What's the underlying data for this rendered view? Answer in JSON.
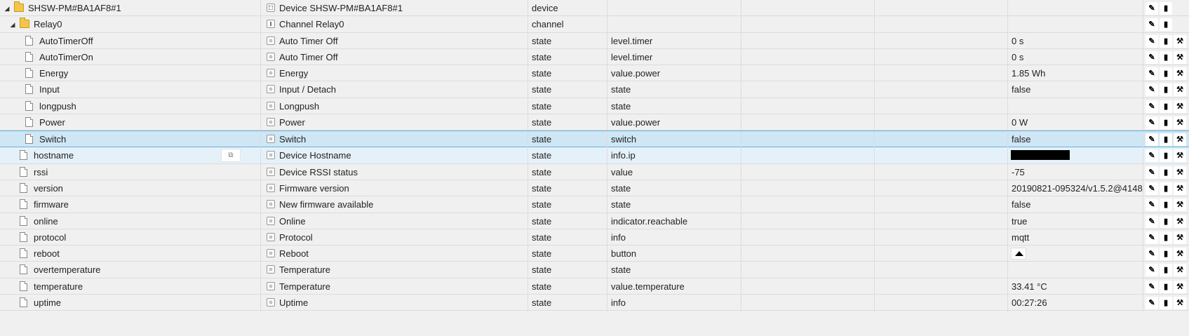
{
  "rows": [
    {
      "id": "SHSW-PM#BA1AF8#1",
      "name": "Device SHSW-PM#BA1AF8#1",
      "type": "device",
      "role": "",
      "value": "",
      "kind": "folder",
      "expand": "◢",
      "indent": 0,
      "icon": "device",
      "actions": 2
    },
    {
      "id": "Relay0",
      "name": "Channel Relay0",
      "type": "channel",
      "role": "",
      "value": "",
      "kind": "folder",
      "expand": "◢",
      "indent": 1,
      "icon": "channel",
      "actions": 2
    },
    {
      "id": "AutoTimerOff",
      "name": "Auto Timer Off",
      "type": "state",
      "role": "level.timer",
      "value": "0 s",
      "kind": "file",
      "indent": 2,
      "icon": "state",
      "actions": 3
    },
    {
      "id": "AutoTimerOn",
      "name": "Auto Timer Off",
      "type": "state",
      "role": "level.timer",
      "value": "0 s",
      "kind": "file",
      "indent": 2,
      "icon": "state",
      "actions": 3
    },
    {
      "id": "Energy",
      "name": "Energy",
      "type": "state",
      "role": "value.power",
      "value": "1.85 Wh",
      "kind": "file",
      "indent": 2,
      "icon": "state",
      "actions": 3
    },
    {
      "id": "Input",
      "name": "Input / Detach",
      "type": "state",
      "role": "state",
      "value": "false",
      "kind": "file",
      "indent": 2,
      "icon": "state",
      "actions": 3
    },
    {
      "id": "longpush",
      "name": "Longpush",
      "type": "state",
      "role": "state",
      "value": "",
      "kind": "file",
      "indent": 2,
      "icon": "state",
      "actions": 3
    },
    {
      "id": "Power",
      "name": "Power",
      "type": "state",
      "role": "value.power",
      "value": "0 W",
      "kind": "file",
      "indent": 2,
      "icon": "state",
      "actions": 3
    },
    {
      "id": "Switch",
      "name": "Switch",
      "type": "state",
      "role": "switch",
      "value": "false",
      "kind": "file",
      "indent": 2,
      "icon": "state",
      "actions": 3,
      "selected": true
    },
    {
      "id": "hostname",
      "name": "Device Hostname",
      "type": "state",
      "role": "info.ip",
      "value": "",
      "kind": "file",
      "indent": 1,
      "icon": "state",
      "actions": 3,
      "hover": true,
      "redacted": true
    },
    {
      "id": "rssi",
      "name": "Device RSSI status",
      "type": "state",
      "role": "value",
      "value": "-75",
      "kind": "file",
      "indent": 1,
      "icon": "state",
      "actions": 3
    },
    {
      "id": "version",
      "name": "Firmware version",
      "type": "state",
      "role": "state",
      "value": "20190821-095324/v1.5.2@4148",
      "kind": "file",
      "indent": 1,
      "icon": "state",
      "actions": 3
    },
    {
      "id": "firmware",
      "name": "New firmware available",
      "type": "state",
      "role": "state",
      "value": "false",
      "kind": "file",
      "indent": 1,
      "icon": "state",
      "actions": 3
    },
    {
      "id": "online",
      "name": "Online",
      "type": "state",
      "role": "indicator.reachable",
      "value": "true",
      "kind": "file",
      "indent": 1,
      "icon": "state",
      "actions": 3
    },
    {
      "id": "protocol",
      "name": "Protocol",
      "type": "state",
      "role": "info",
      "value": "mqtt",
      "kind": "file",
      "indent": 1,
      "icon": "state",
      "actions": 3
    },
    {
      "id": "reboot",
      "name": "Reboot",
      "type": "state",
      "role": "button",
      "value": "",
      "kind": "file",
      "indent": 1,
      "icon": "state",
      "actions": 3,
      "button": true
    },
    {
      "id": "overtemperature",
      "name": "Temperature",
      "type": "state",
      "role": "state",
      "value": "",
      "kind": "file",
      "indent": 1,
      "icon": "state",
      "actions": 3
    },
    {
      "id": "temperature",
      "name": "Temperature",
      "type": "state",
      "role": "value.temperature",
      "value": "33.41 °C",
      "kind": "file",
      "indent": 1,
      "icon": "state",
      "actions": 3
    },
    {
      "id": "uptime",
      "name": "Uptime",
      "type": "state",
      "role": "info",
      "value": "00:27:26",
      "kind": "file",
      "indent": 1,
      "icon": "state",
      "actions": 3
    }
  ],
  "icons": {
    "edit": "pencil-icon",
    "delete": "trash-icon",
    "config": "wrench-icon",
    "copy": "copy-icon"
  },
  "colors": {
    "selected_row": "#cfe6f4",
    "hover_row": "#e5f1f9",
    "folder": "#f3c64a"
  }
}
